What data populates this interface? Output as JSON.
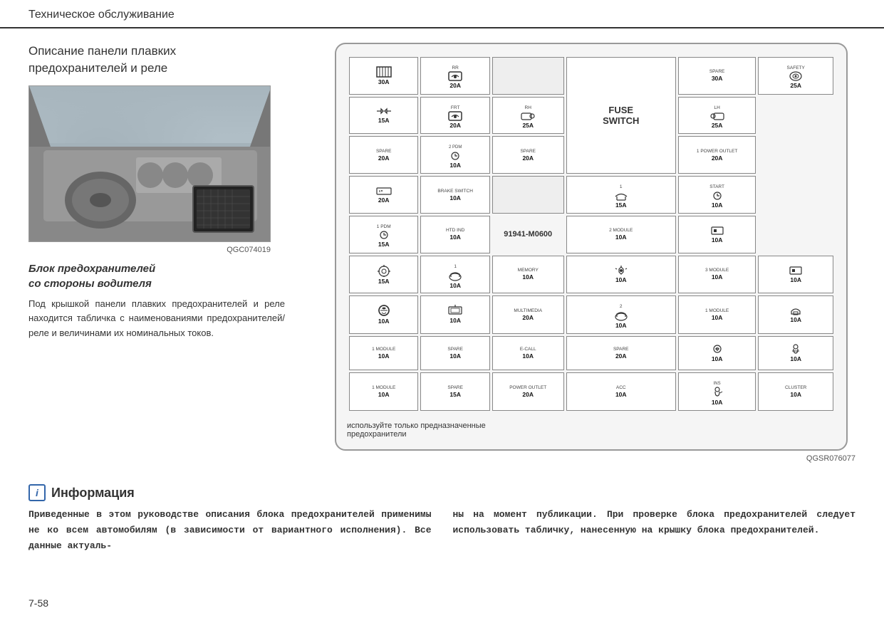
{
  "header": {
    "title": "Техническое обслуживание"
  },
  "left": {
    "section_title": "Описание панели плавких\nпредохранителей и реле",
    "image_code": "QGC074019",
    "box_title_line1": "Блок предохранителей",
    "box_title_line2": "со стороны водителя",
    "description": "Под крышкой панели плавких предохранителей и реле находится табличка с наименованиями предохранителей/реле и величинами их номинальных токов."
  },
  "diagram": {
    "image_code": "QGSR076077",
    "note_line1": "используйте только предназначенные",
    "note_line2": "предохранители",
    "part_number": "91941-M0600",
    "fuse_switch_label": "FUSE\nSWITCH"
  },
  "info": {
    "icon": "i",
    "title": "Информация",
    "text_left": "Приведенные в этом руководстве описания блока предохранителей применимы не ко всем автомобилям (в зависимости от вариантного исполнения). Все данные актуаль-",
    "text_right": "ны на момент публикации. При проверке блока предохранителей следует использовать табличку, нанесенную на крышку блока предохранителей."
  },
  "page_number": "7-58",
  "fuse_rows": [
    [
      {
        "icon": "grid",
        "amp": "30A",
        "label": ""
      },
      {
        "icon": "RR",
        "sub": "RR",
        "ico_type": "seat_heat",
        "amp": "20A",
        "label": ""
      },
      {
        "type": "empty"
      },
      {
        "label": "SPARE",
        "amp": "30A"
      },
      {
        "sub": "SAFETY",
        "ico_type": "airbag",
        "amp": "25A"
      }
    ],
    [
      {
        "ico_type": "arrows",
        "amp": "15A"
      },
      {
        "sub": "FRT",
        "ico_type": "seat_heat",
        "amp": "20A"
      },
      {
        "type": "fuse_switch",
        "rowspan": 3
      },
      {
        "sub": "RH",
        "ico_type": "mirror",
        "amp": "25A"
      },
      {
        "sub": "LH",
        "ico_type": "mirror",
        "amp": "25A"
      }
    ],
    [
      {
        "label": "SPARE",
        "amp": "20A"
      },
      {
        "sub": "2\nPDM",
        "num": "2",
        "ico_type": "pdm",
        "amp": "10A"
      },
      {
        "label": "SPARE",
        "amp": "20A"
      },
      {
        "num": "1",
        "label": "POWER\nOUTLET",
        "amp": "20A"
      }
    ],
    [
      {
        "ico_type": "car_elec",
        "amp": "20A"
      },
      {
        "label": "BRAKE\nSWITCH",
        "amp": "10A"
      },
      {
        "num": "1",
        "ico_type": "engine",
        "amp": "15A"
      },
      {
        "label": "START",
        "ico_type": "start",
        "amp": "10A"
      }
    ],
    [
      {
        "num": "1",
        "label": "PDM",
        "ico_type": "pdm_small",
        "amp": "15A"
      },
      {
        "label": "HTD IND",
        "amp": "10A"
      },
      {
        "label": "part_number"
      },
      {
        "num": "2",
        "label": "MODULE",
        "amp": "10A"
      },
      {
        "ico_type": "engine2",
        "amp": "10A"
      }
    ],
    [
      {
        "ico_type": "settings",
        "amp": "15A"
      },
      {
        "num": "1",
        "ico_type": "fan",
        "amp": "10A"
      },
      {
        "label": "MEMORY",
        "amp": "10A"
      },
      {
        "ico_type": "sun_sensor",
        "amp": "10A"
      },
      {
        "num": "3",
        "label": "MODULE",
        "amp": "10A"
      },
      {
        "ico_type": "engine2",
        "amp": "10A"
      }
    ],
    [
      {
        "ico_type": "sun",
        "amp": "10A"
      },
      {
        "ico_type": "monitor",
        "amp": "10A"
      },
      {
        "label": "MULTIMEDIA",
        "amp": "20A"
      },
      {
        "num": "2",
        "ico_type": "fan",
        "amp": "10A"
      },
      {
        "num": "1",
        "label": "MODULE",
        "amp": "10A"
      },
      {
        "ico_type": "car_service",
        "amp": "10A"
      }
    ],
    [
      {
        "num": "1",
        "label": "MODULE",
        "amp": "10A"
      },
      {
        "label": "SPARE",
        "amp": "10A"
      },
      {
        "label": "E-CALL",
        "amp": "10A"
      },
      {
        "label": "SPARE",
        "amp": "20A"
      },
      {
        "ico_type": "eco",
        "amp": "10A"
      },
      {
        "ico_type": "person_run",
        "amp": "10A"
      }
    ],
    [
      {
        "num": "1",
        "label": "MODULE",
        "amp": "10A"
      },
      {
        "label": "SPARE",
        "amp": "15A"
      },
      {
        "label": "POWER\nOUTLET",
        "amp": "20A"
      },
      {
        "label": "ACC",
        "amp": "10A"
      },
      {
        "sub": "INS",
        "ico_type": "person2",
        "amp": "10A"
      },
      {
        "label": "CLUSTER",
        "amp": "10A"
      }
    ]
  ]
}
